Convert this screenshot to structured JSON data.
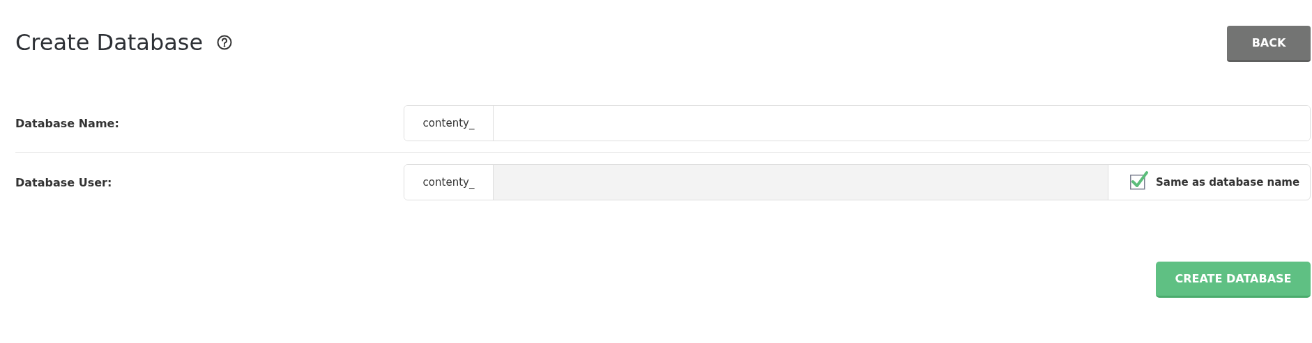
{
  "header": {
    "title": "Create Database",
    "back_button": "BACK"
  },
  "fields": [
    {
      "label": "Database Name:",
      "prefix": "contenty_",
      "disabled": false
    },
    {
      "label": "Database User:",
      "prefix": "contenty_",
      "disabled": true,
      "option": {
        "label": "Same as database name",
        "checked": true
      }
    }
  ],
  "submit_button": "CREATE DATABASE"
}
